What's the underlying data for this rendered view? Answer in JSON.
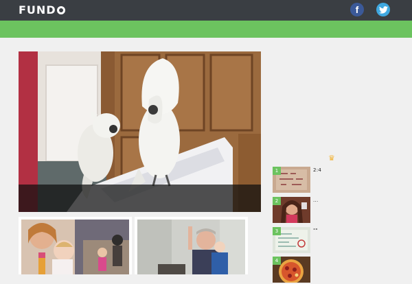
{
  "header": {
    "logo": "FUNDO",
    "tagline": "",
    "facebook_label": "",
    "facebook_icon": "facebook-icon",
    "twitter_label": "",
    "twitter_icon": "twitter-icon"
  },
  "nav": {
    "items": [
      {
        "label": ""
      },
      {
        "label": ""
      },
      {
        "label": ""
      },
      {
        "label": ""
      }
    ]
  },
  "hero": {
    "title": ""
  },
  "sidebar": {
    "heading": "",
    "crown_icon": "crown-icon",
    "items": [
      {
        "rank": "1",
        "title": "2:4"
      },
      {
        "rank": "2",
        "title": "..."
      },
      {
        "rank": "3",
        "title": "\"\""
      },
      {
        "rank": "4",
        "title": ""
      }
    ]
  },
  "colors": {
    "topbar": "#3a3e43",
    "nav": "#6cc35f",
    "badge": "#6cc35f",
    "facebook": "#3b5998",
    "twitter": "#3fa8e0"
  }
}
